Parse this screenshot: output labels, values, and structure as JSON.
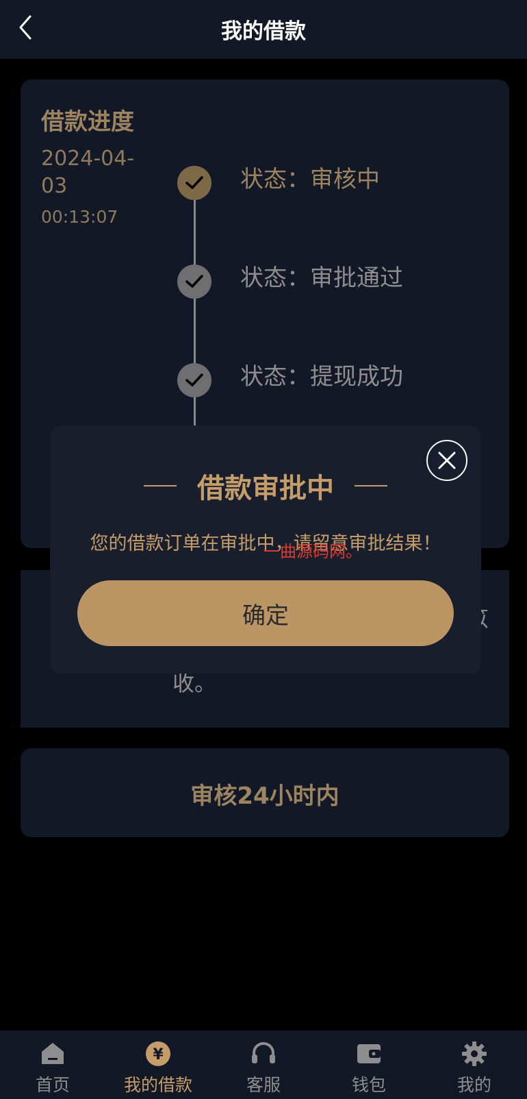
{
  "header": {
    "title": "我的借款"
  },
  "progress": {
    "title": "借款进度",
    "date_part1": "2024-04-",
    "date_part2": "03",
    "time": "00:13:07",
    "steps": [
      {
        "label": "状态：审核中",
        "state": "active"
      },
      {
        "label": "状态：审批通过",
        "state": "done"
      },
      {
        "label": "状态：提现成功",
        "state": "done"
      }
    ]
  },
  "info": {
    "visible_fragment": "收。",
    "edge_text_1": "笖",
    "edge_text_2": "："
  },
  "review": {
    "text": "审核24小时内"
  },
  "modal": {
    "title": "借款审批中",
    "message": "您的借款订单在审批中，请留意审批结果！",
    "watermark": "一曲源码网。",
    "confirm_label": "确定"
  },
  "tabbar": {
    "items": [
      {
        "label": "首页",
        "icon": "home-icon"
      },
      {
        "label": "我的借款",
        "icon": "yen-coin-icon",
        "active": true
      },
      {
        "label": "客服",
        "icon": "headset-icon"
      },
      {
        "label": "钱包",
        "icon": "wallet-icon"
      },
      {
        "label": "我的",
        "icon": "gear-icon"
      }
    ]
  },
  "colors": {
    "gold": "#c59d6a",
    "muted_gold": "#9c8461",
    "card_bg": "#121826",
    "button_bg": "#bb9664"
  }
}
